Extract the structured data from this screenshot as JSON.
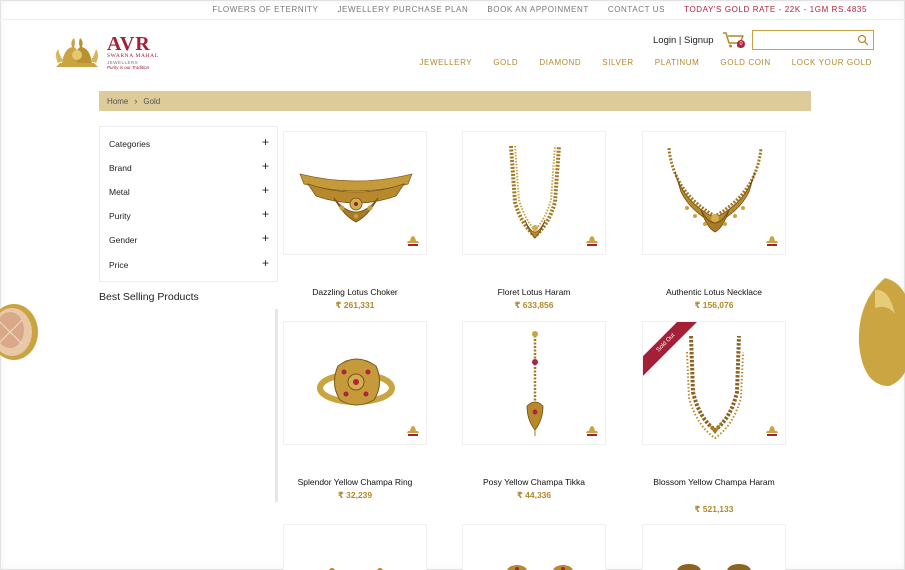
{
  "topbar": {
    "links": [
      "FLOWERS OF ETERNITY",
      "JEWELLERY PURCHASE PLAN",
      "BOOK AN APPOINMENT",
      "CONTACT US"
    ],
    "gold_rate": "TODAY'S GOLD RATE - 22K - 1GM Rs.4835"
  },
  "logo": {
    "brand": "AVR",
    "subtitle": "SWARNA MAHAL",
    "subtitle2": "JEWELLERS",
    "tagline": "Purity is our Tradition"
  },
  "header": {
    "login_label": "Login",
    "separator": "|",
    "signup_label": "Signup",
    "cart_count": "0",
    "search_placeholder": ""
  },
  "nav": {
    "items": [
      "JEWELLERY",
      "GOLD",
      "DIAMOND",
      "SILVER",
      "PLATINUM",
      "GOLD COIN",
      "LOCK YOUR GOLD"
    ]
  },
  "breadcrumb": {
    "home": "Home",
    "separator": "›",
    "current": "Gold"
  },
  "filters": {
    "plus_symbol": "+",
    "items": [
      "Categories",
      "Brand",
      "Metal",
      "Purity",
      "Gender",
      "Price"
    ]
  },
  "sidebar": {
    "best_selling_title": "Best Selling Products"
  },
  "products": [
    {
      "name": "Dazzling Lotus Choker",
      "price": "₹ 261,331",
      "sold_out": false
    },
    {
      "name": "Floret Lotus Haram",
      "price": "₹ 633,856",
      "sold_out": false
    },
    {
      "name": "Authentic Lotus Necklace",
      "price": "₹ 156,076",
      "sold_out": false
    },
    {
      "name": "Splendor Yellow Champa Ring",
      "price": "₹ 32,239",
      "sold_out": false
    },
    {
      "name": "Posy Yellow Champa Tikka",
      "price": "₹ 44,336",
      "sold_out": false
    },
    {
      "name": "Blossom Yellow Champa Haram",
      "price": "₹ 521,133",
      "sold_out": true,
      "sold_out_label": "Sold Out"
    }
  ],
  "colors": {
    "accent_gold": "#b1892b",
    "brand_red": "#a32036",
    "breadcrumb_bg": "#ddcc9a"
  }
}
